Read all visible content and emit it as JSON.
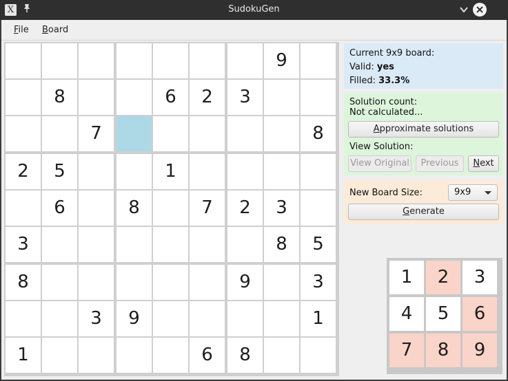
{
  "window": {
    "title": "SudokuGen"
  },
  "menu": {
    "file": {
      "accel": "F",
      "rest": "ile"
    },
    "board": {
      "accel": "B",
      "rest": "oard"
    }
  },
  "board": {
    "rows": [
      [
        "",
        "",
        "",
        "",
        "",
        "",
        "",
        "9",
        ""
      ],
      [
        "",
        "8",
        "",
        "",
        "6",
        "2",
        "3",
        "",
        ""
      ],
      [
        "",
        "",
        "7",
        "",
        "",
        "",
        "",
        "",
        "8"
      ],
      [
        "2",
        "5",
        "",
        "",
        "1",
        "",
        "",
        "",
        ""
      ],
      [
        "",
        "6",
        "",
        "8",
        "",
        "7",
        "2",
        "3",
        ""
      ],
      [
        "3",
        "",
        "",
        "",
        "",
        "",
        "",
        "8",
        "5"
      ],
      [
        "8",
        "",
        "",
        "",
        "",
        "",
        "9",
        "",
        "3"
      ],
      [
        "",
        "",
        "3",
        "9",
        "",
        "",
        "",
        "",
        "1"
      ],
      [
        "1",
        "",
        "",
        "",
        "",
        "6",
        "8",
        "",
        ""
      ]
    ],
    "selected": {
      "row": 2,
      "col": 3
    },
    "selected_color": "#add8e6"
  },
  "info": {
    "heading": "Current 9x9 board:",
    "valid_label": "Valid:",
    "valid_value": "yes",
    "filled_label": "Filled:",
    "filled_value": "33.3%"
  },
  "solutions": {
    "count_label": "Solution count:",
    "count_value": "Not calculated...",
    "approx_button": {
      "accel": "A",
      "rest": "pproximate solutions"
    },
    "view_label": "View Solution:",
    "view_original_button": "View Original",
    "previous_button": "Previous",
    "next_button": {
      "accel": "N",
      "rest": "ext"
    }
  },
  "generator": {
    "size_label": "New Board Size:",
    "size_value": "9x9",
    "generate_button": {
      "accel": "G",
      "rest": "enerate"
    }
  },
  "keypad": {
    "keys": [
      "1",
      "2",
      "3",
      "4",
      "5",
      "6",
      "7",
      "8",
      "9"
    ],
    "highlighted": [
      "2",
      "6",
      "7",
      "8",
      "9"
    ],
    "highlight_color": "#fad4c8"
  },
  "colors": {
    "info_panel": "#dbeaf7",
    "solution_panel": "#ddf5db",
    "generate_panel": "#fcebd9"
  }
}
